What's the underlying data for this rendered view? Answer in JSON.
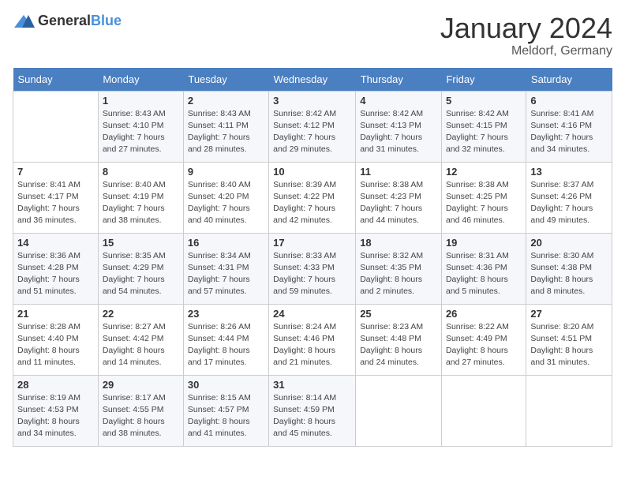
{
  "logo": {
    "general": "General",
    "blue": "Blue"
  },
  "title": "January 2024",
  "location": "Meldorf, Germany",
  "days_of_week": [
    "Sunday",
    "Monday",
    "Tuesday",
    "Wednesday",
    "Thursday",
    "Friday",
    "Saturday"
  ],
  "weeks": [
    [
      {
        "num": "",
        "empty": true
      },
      {
        "num": "1",
        "sunrise": "Sunrise: 8:43 AM",
        "sunset": "Sunset: 4:10 PM",
        "daylight": "Daylight: 7 hours and 27 minutes."
      },
      {
        "num": "2",
        "sunrise": "Sunrise: 8:43 AM",
        "sunset": "Sunset: 4:11 PM",
        "daylight": "Daylight: 7 hours and 28 minutes."
      },
      {
        "num": "3",
        "sunrise": "Sunrise: 8:42 AM",
        "sunset": "Sunset: 4:12 PM",
        "daylight": "Daylight: 7 hours and 29 minutes."
      },
      {
        "num": "4",
        "sunrise": "Sunrise: 8:42 AM",
        "sunset": "Sunset: 4:13 PM",
        "daylight": "Daylight: 7 hours and 31 minutes."
      },
      {
        "num": "5",
        "sunrise": "Sunrise: 8:42 AM",
        "sunset": "Sunset: 4:15 PM",
        "daylight": "Daylight: 7 hours and 32 minutes."
      },
      {
        "num": "6",
        "sunrise": "Sunrise: 8:41 AM",
        "sunset": "Sunset: 4:16 PM",
        "daylight": "Daylight: 7 hours and 34 minutes."
      }
    ],
    [
      {
        "num": "7",
        "sunrise": "Sunrise: 8:41 AM",
        "sunset": "Sunset: 4:17 PM",
        "daylight": "Daylight: 7 hours and 36 minutes."
      },
      {
        "num": "8",
        "sunrise": "Sunrise: 8:40 AM",
        "sunset": "Sunset: 4:19 PM",
        "daylight": "Daylight: 7 hours and 38 minutes."
      },
      {
        "num": "9",
        "sunrise": "Sunrise: 8:40 AM",
        "sunset": "Sunset: 4:20 PM",
        "daylight": "Daylight: 7 hours and 40 minutes."
      },
      {
        "num": "10",
        "sunrise": "Sunrise: 8:39 AM",
        "sunset": "Sunset: 4:22 PM",
        "daylight": "Daylight: 7 hours and 42 minutes."
      },
      {
        "num": "11",
        "sunrise": "Sunrise: 8:38 AM",
        "sunset": "Sunset: 4:23 PM",
        "daylight": "Daylight: 7 hours and 44 minutes."
      },
      {
        "num": "12",
        "sunrise": "Sunrise: 8:38 AM",
        "sunset": "Sunset: 4:25 PM",
        "daylight": "Daylight: 7 hours and 46 minutes."
      },
      {
        "num": "13",
        "sunrise": "Sunrise: 8:37 AM",
        "sunset": "Sunset: 4:26 PM",
        "daylight": "Daylight: 7 hours and 49 minutes."
      }
    ],
    [
      {
        "num": "14",
        "sunrise": "Sunrise: 8:36 AM",
        "sunset": "Sunset: 4:28 PM",
        "daylight": "Daylight: 7 hours and 51 minutes."
      },
      {
        "num": "15",
        "sunrise": "Sunrise: 8:35 AM",
        "sunset": "Sunset: 4:29 PM",
        "daylight": "Daylight: 7 hours and 54 minutes."
      },
      {
        "num": "16",
        "sunrise": "Sunrise: 8:34 AM",
        "sunset": "Sunset: 4:31 PM",
        "daylight": "Daylight: 7 hours and 57 minutes."
      },
      {
        "num": "17",
        "sunrise": "Sunrise: 8:33 AM",
        "sunset": "Sunset: 4:33 PM",
        "daylight": "Daylight: 7 hours and 59 minutes."
      },
      {
        "num": "18",
        "sunrise": "Sunrise: 8:32 AM",
        "sunset": "Sunset: 4:35 PM",
        "daylight": "Daylight: 8 hours and 2 minutes."
      },
      {
        "num": "19",
        "sunrise": "Sunrise: 8:31 AM",
        "sunset": "Sunset: 4:36 PM",
        "daylight": "Daylight: 8 hours and 5 minutes."
      },
      {
        "num": "20",
        "sunrise": "Sunrise: 8:30 AM",
        "sunset": "Sunset: 4:38 PM",
        "daylight": "Daylight: 8 hours and 8 minutes."
      }
    ],
    [
      {
        "num": "21",
        "sunrise": "Sunrise: 8:28 AM",
        "sunset": "Sunset: 4:40 PM",
        "daylight": "Daylight: 8 hours and 11 minutes."
      },
      {
        "num": "22",
        "sunrise": "Sunrise: 8:27 AM",
        "sunset": "Sunset: 4:42 PM",
        "daylight": "Daylight: 8 hours and 14 minutes."
      },
      {
        "num": "23",
        "sunrise": "Sunrise: 8:26 AM",
        "sunset": "Sunset: 4:44 PM",
        "daylight": "Daylight: 8 hours and 17 minutes."
      },
      {
        "num": "24",
        "sunrise": "Sunrise: 8:24 AM",
        "sunset": "Sunset: 4:46 PM",
        "daylight": "Daylight: 8 hours and 21 minutes."
      },
      {
        "num": "25",
        "sunrise": "Sunrise: 8:23 AM",
        "sunset": "Sunset: 4:48 PM",
        "daylight": "Daylight: 8 hours and 24 minutes."
      },
      {
        "num": "26",
        "sunrise": "Sunrise: 8:22 AM",
        "sunset": "Sunset: 4:49 PM",
        "daylight": "Daylight: 8 hours and 27 minutes."
      },
      {
        "num": "27",
        "sunrise": "Sunrise: 8:20 AM",
        "sunset": "Sunset: 4:51 PM",
        "daylight": "Daylight: 8 hours and 31 minutes."
      }
    ],
    [
      {
        "num": "28",
        "sunrise": "Sunrise: 8:19 AM",
        "sunset": "Sunset: 4:53 PM",
        "daylight": "Daylight: 8 hours and 34 minutes."
      },
      {
        "num": "29",
        "sunrise": "Sunrise: 8:17 AM",
        "sunset": "Sunset: 4:55 PM",
        "daylight": "Daylight: 8 hours and 38 minutes."
      },
      {
        "num": "30",
        "sunrise": "Sunrise: 8:15 AM",
        "sunset": "Sunset: 4:57 PM",
        "daylight": "Daylight: 8 hours and 41 minutes."
      },
      {
        "num": "31",
        "sunrise": "Sunrise: 8:14 AM",
        "sunset": "Sunset: 4:59 PM",
        "daylight": "Daylight: 8 hours and 45 minutes."
      },
      {
        "num": "",
        "empty": true
      },
      {
        "num": "",
        "empty": true
      },
      {
        "num": "",
        "empty": true
      }
    ]
  ]
}
